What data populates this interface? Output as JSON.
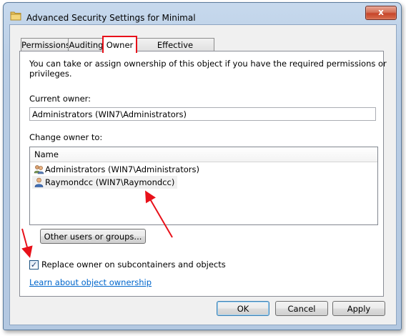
{
  "window": {
    "title": "Advanced Security Settings for Minimal",
    "close_glyph": "x"
  },
  "tabs": [
    {
      "label": "Permissions"
    },
    {
      "label": "Auditing"
    },
    {
      "label": "Owner",
      "active": true
    },
    {
      "label": "Effective Permissions"
    }
  ],
  "owner_tab": {
    "intro": "You can take or assign ownership of this object if you have the required permissions or privileges.",
    "current_owner_label": "Current owner:",
    "current_owner_value": "Administrators (WIN7\\Administrators)",
    "change_owner_label": "Change owner to:",
    "list_header": "Name",
    "list_items": [
      {
        "label": "Administrators (WIN7\\Administrators)",
        "icon": "user-group-icon"
      },
      {
        "label": "Raymondcc (WIN7\\Raymondcc)",
        "icon": "user-icon",
        "selected": true
      }
    ],
    "other_users_button": "Other users or groups...",
    "replace_owner_label": "Replace owner on subcontainers and objects",
    "replace_owner_checked": true,
    "learn_link": "Learn about object ownership"
  },
  "buttons": {
    "ok": "OK",
    "cancel": "Cancel",
    "apply": "Apply"
  },
  "colors": {
    "highlight_red": "#e8111a",
    "link_blue": "#0066cc"
  }
}
